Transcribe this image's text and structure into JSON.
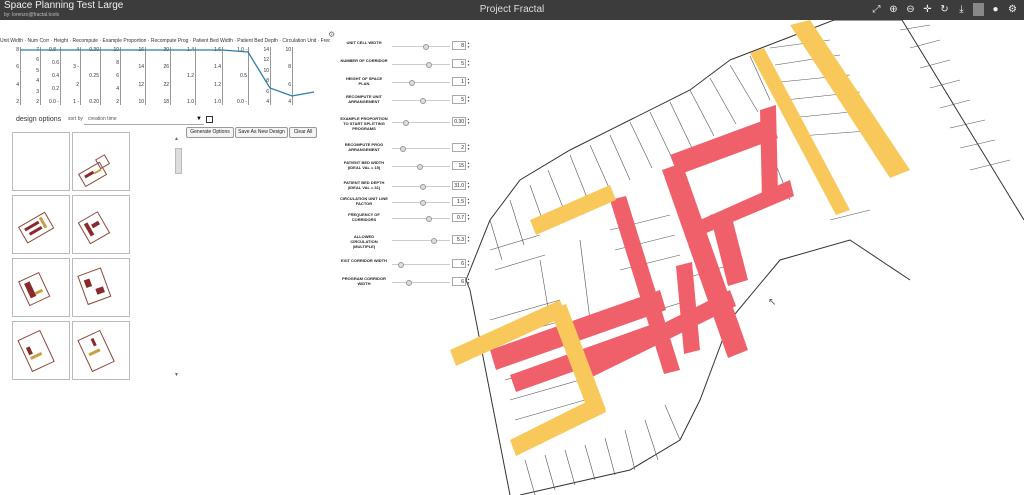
{
  "app": {
    "title": "Space Planning Test Large",
    "subtitle": "by: lorenzo@fractal.tools",
    "project_title": "Project Fractal"
  },
  "toolbar": {
    "icons": [
      "zoom-extents-icon",
      "zoom-in-icon",
      "zoom-out-icon",
      "pan-icon",
      "refresh-icon",
      "download-icon",
      "comment-icon",
      "settings-icon"
    ]
  },
  "parallel_coords": {
    "header": "Unit Width · Num Corr · Height · Recompute · Example Proportion · Recompute Prog · Patient Bed Width · Patient Bed Depth · Circulation Unit · Frequency · Allowed Circulation · Corridor Width",
    "axes": [
      {
        "ticks": [
          "8",
          "6",
          "4",
          "2"
        ]
      },
      {
        "ticks": [
          "7",
          "6",
          "5",
          "4",
          "3",
          "2"
        ]
      },
      {
        "ticks": [
          "0.8 -",
          "0.6",
          "0.4",
          "0.2",
          "0.0 -"
        ]
      },
      {
        "ticks": [
          "4",
          "3 -",
          "2",
          "1 -"
        ]
      },
      {
        "ticks": [
          "0.30",
          "0.25",
          "0.20"
        ]
      },
      {
        "ticks": [
          "10",
          "8",
          "6",
          "4",
          "2"
        ]
      },
      {
        "ticks": [
          "16",
          "14",
          "12",
          "10"
        ]
      },
      {
        "ticks": [
          "30",
          "26",
          "22",
          "18"
        ]
      },
      {
        "ticks": [
          "1.4",
          "1.2",
          "1.0"
        ]
      },
      {
        "ticks": [
          "1.6",
          "1.4",
          "1.2",
          "1.0"
        ]
      },
      {
        "ticks": [
          "1.0 -",
          "0.5",
          "0.0 -"
        ]
      },
      {
        "ticks": [
          "14",
          "12",
          "10",
          "8",
          "6",
          "4"
        ]
      },
      {
        "ticks": [
          "10",
          "8",
          "6",
          "4"
        ]
      }
    ]
  },
  "design_options": {
    "label": "design options",
    "sort_label": "sort by",
    "sort_value": "creation time",
    "buttons": {
      "generate": "Generate Options",
      "save": "Save As New Design",
      "clear": "Clear All"
    }
  },
  "parameters": [
    {
      "label": "UNIT CELL WIDTH",
      "value": "8",
      "pos": 0.55
    },
    {
      "label": "NUMBER OF CORRIDOR",
      "value": "5",
      "pos": 0.6
    },
    {
      "label": "HEIGHT OF SPACE PLAN",
      "value": "1",
      "pos": 0.3
    },
    {
      "label": "RECOMPUTE UNIT ARRANGEMENT",
      "value": "5",
      "pos": 0.5
    },
    {
      "label": "EXAMPLE PROPORTION TO START SPLITTING PROGRAMS",
      "value": "0.30",
      "pos": 0.2
    },
    {
      "label": "RECOMPUTE PROG ARRANGEMENT",
      "value": "2",
      "pos": 0.15
    },
    {
      "label": "PATIENT BED WIDTH (IDEAL VAL = 15)",
      "value": "15",
      "pos": 0.45
    },
    {
      "label": "PATIENT BED DEPTH (IDEAL VAL = 31)",
      "value": "31.0",
      "pos": 0.5
    },
    {
      "label": "CIRCULATION UNIT LINE FACTOR",
      "value": "1.5",
      "pos": 0.5
    },
    {
      "label": "FREQUENCY OF CORRIDORS",
      "value": "0.7",
      "pos": 0.6
    },
    {
      "label": "ALLOWED CIRCULATION (MULTIPLE)",
      "value": "5.3",
      "pos": 0.7
    },
    {
      "label": "EXIT CORRIDOR WIDTH",
      "value": "6",
      "pos": 0.1
    },
    {
      "label": "PROGRAM CORRIDOR WIDTH",
      "value": "6",
      "pos": 0.25
    }
  ],
  "colors": {
    "corridor_red": "#f0606a",
    "corridor_yellow": "#f8c95a",
    "topbar": "#3c3c3c"
  }
}
